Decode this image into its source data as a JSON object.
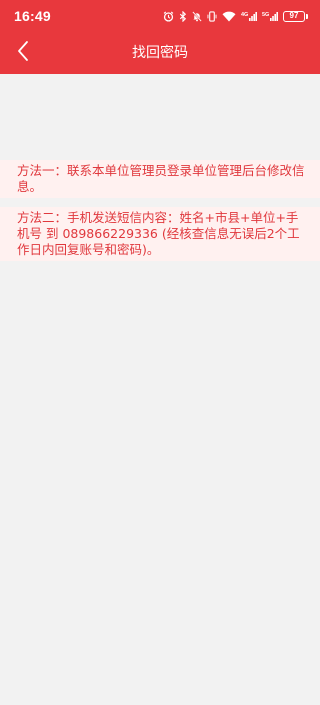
{
  "status_bar": {
    "time": "16:49",
    "icons": [
      "alarm-icon",
      "bluetooth-icon",
      "mute-icon",
      "vibrate-icon",
      "wifi-icon",
      "signal-4g-icon",
      "signal-5g-icon",
      "battery-icon"
    ],
    "battery_level": "97",
    "network_1": "4G",
    "network_2": "5G"
  },
  "nav": {
    "back_icon": "chevron-left-icon",
    "title": "找回密码"
  },
  "methods": [
    {
      "text": "方法一：联系本单位管理员登录单位管理后台修改信息。"
    },
    {
      "text": "方法二：手机发送短信内容：姓名+市县+单位+手机号 到 089866229336 (经核查信息无误后2个工作日内回复账号和密码)。"
    }
  ],
  "colors": {
    "brand_red": "#e8383d",
    "text_red": "#e0383d",
    "notice_bg": "#fff1f0",
    "page_bg": "#f2f2f2"
  }
}
